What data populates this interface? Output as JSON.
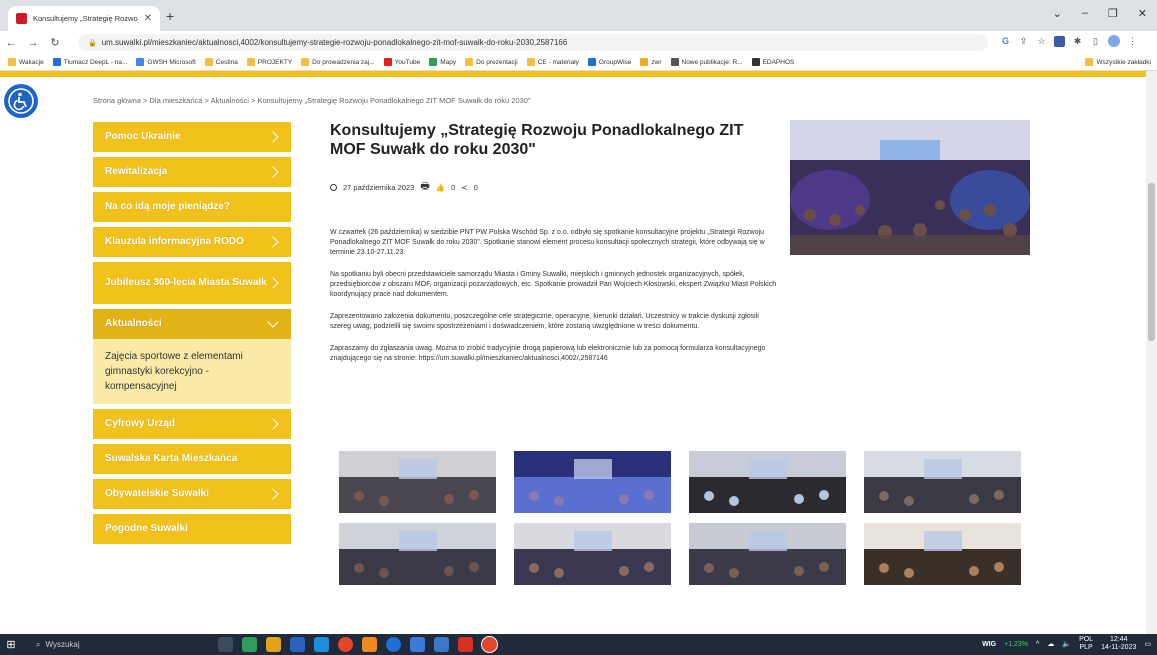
{
  "browser": {
    "tab_title": "Konsultujemy „Strategię Rozwoju",
    "url": "um.suwalki.pl/mieszkaniec/aktualnosci,4002/konsultujemy-strategie-rozwoju-ponadlokalnego-zit-mof-suwalk-do-roku-2030,2587166",
    "bookmarks": [
      "Wakacje",
      "Tłumacz DeepL - na...",
      "GWSH Microsoft",
      "Cestina",
      "PROJEKTY",
      "Do prowadzenia zaj...",
      "YouTube",
      "Mapy",
      "Do prezentacji",
      "CE - materiały",
      "GroupWise",
      "zwr",
      "Nowe publikacje: R...",
      "EDAPHOS"
    ],
    "all_bookmarks": "Wszystkie zakładki"
  },
  "breadcrumb": "Strona główna > Dla mieszkańca > Aktualności > Konsultujemy „Strategię Rozwoju Ponadlokalnego ZIT MOF Suwałk do roku 2030\"",
  "menu": {
    "items": [
      {
        "label": "Pomoc Ukrainie",
        "chev": true
      },
      {
        "label": "Rewitalizacja",
        "chev": true
      },
      {
        "label": "Na co idą moje pieniądze?",
        "chev": false
      },
      {
        "label": "Klauzula informacyjna RODO",
        "chev": true
      },
      {
        "label": "Jubileusz 300-lecia Miasta Suwałk",
        "chev": true
      },
      {
        "label": "Aktualności",
        "chev": true,
        "active": true
      },
      {
        "label": "Cyfrowy Urząd",
        "chev": true
      },
      {
        "label": "Suwalska Karta Mieszkańca",
        "chev": false
      },
      {
        "label": "Obywatelskie Suwałki",
        "chev": true
      },
      {
        "label": "Pogodne Suwałki",
        "chev": false
      }
    ],
    "submenu": "Zajęcia sportowe z elementami gimnastyki korekcyjno - kompensacyjnej"
  },
  "article": {
    "title": "Konsultujemy „Strategię Rozwoju Ponadlokalnego ZIT MOF Suwałk do roku 2030\"",
    "date": "27 października 2023",
    "likes": "0",
    "shares": "0",
    "paragraphs": [
      "W czwartek (26 października) w siedzibie PNT PW Polska Wschód Sp. z o.o. odbyło się spotkanie konsultacyjne projektu „Strategii Rozwoju Ponadlokalnego ZIT MOF Suwałk do roku 2030\". Spotkanie stanowi element procesu konsultacji społecznych strategii, które odbywają się w terminie 23.10-27.11.23.",
      "Na spotkaniu byli obecni przedstawiciele samorządu Miasta i Gminy Suwałki, miejskich i gminnych jednostek organizacyjnych, spółek, przedsiębiorców z obszaru MOF, organizacji pozarządowych, etc. Spotkanie prowadził Pan Wojciech Kłosowski, ekspert Związku Miast Polskich koordynujący prace nad dokumentem.",
      "Zaprezentowano założenia dokumentu, poszczególne cele strategiczne, operacyjne, kierunki działań. Uczestnicy w trakcie dyskusji zgłosili szereg uwag, podzielili się swoimi spostrzeżeniami i doświadczeniem, które zostaną uwzględnione w treści dokumentu.",
      "Zapraszamy do zgłaszania uwag. Można to zrobić tradycyjnie drogą papierową lub elektronicznie lub za pomocą formularza konsultacyjnego znajdującego się na stronie: https://um.suwalki.pl/mieszkaniec/aktualnosci,4002/,2587146"
    ]
  },
  "gallery_count": 8,
  "taskbar": {
    "search": "Wyszukaj",
    "wig": "WIG",
    "wig_change": "+1,23%",
    "lang1": "POL",
    "lang2": "PLP",
    "time": "12:44",
    "date": "14-11-2023"
  },
  "colors": {
    "brand": "#f1c21b",
    "active": "#e3b217",
    "sub": "#faeaa8",
    "wcag": "#1f63c6"
  }
}
